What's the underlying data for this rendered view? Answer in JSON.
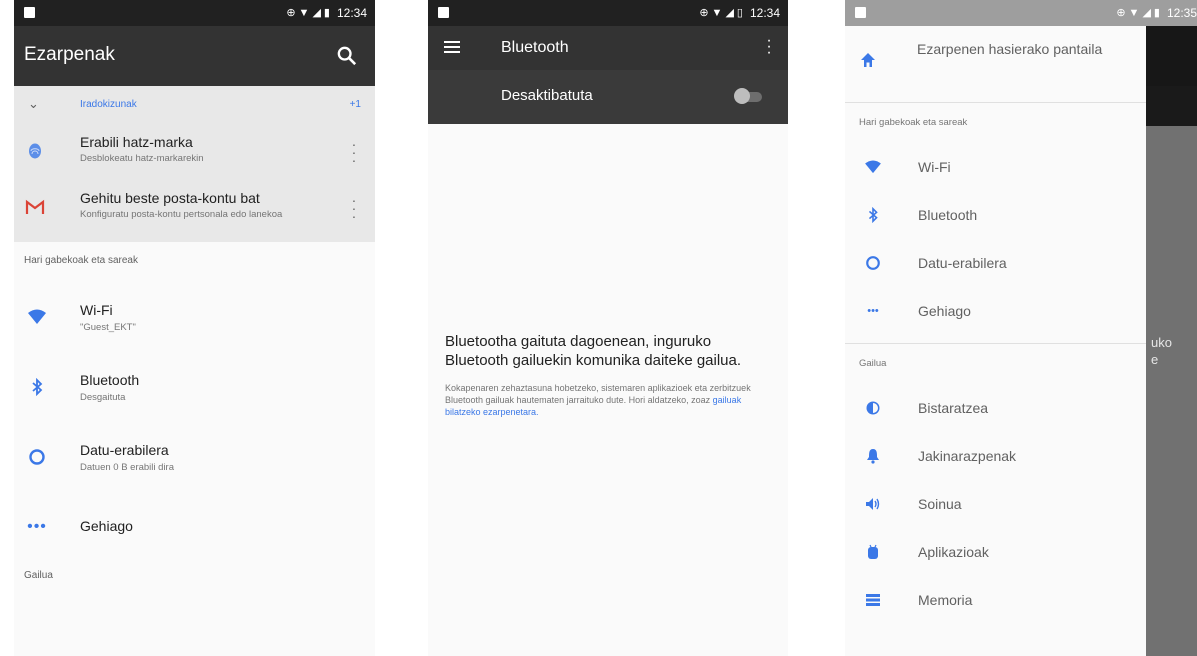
{
  "colors": {
    "accent": "#3b78e7",
    "gmail_red": "#db4437",
    "toolbar": "#333333"
  },
  "screen1": {
    "status": {
      "time": "12:34"
    },
    "toolbar": {
      "title": "Ezarpenak"
    },
    "suggestions": {
      "header": "Iradokizunak",
      "count": "+1",
      "items": [
        {
          "title": "Erabili hatz-marka",
          "subtitle": "Desblokeatu hatz-markarekin",
          "icon": "fingerprint-icon"
        },
        {
          "title": "Gehitu beste posta-kontu bat",
          "subtitle": "Konfiguratu posta-kontu pertsonala edo lanekoa",
          "icon": "gmail-icon"
        }
      ]
    },
    "section_wireless": "Hari gabekoak eta sareak",
    "rows": [
      {
        "title": "Wi-Fi",
        "subtitle": "\"Guest_EKT\"",
        "icon": "wifi-icon"
      },
      {
        "title": "Bluetooth",
        "subtitle": "Desgaituta",
        "icon": "bluetooth-icon"
      },
      {
        "title": "Datu-erabilera",
        "subtitle": "Datuen 0 B erabili dira",
        "icon": "data-usage-icon"
      },
      {
        "title": "Gehiago",
        "icon": "more-horiz-icon"
      }
    ],
    "section_device": "Gailua"
  },
  "screen2": {
    "status": {
      "time": "12:34"
    },
    "toolbar": {
      "title": "Bluetooth"
    },
    "toggle": {
      "label": "Desaktibatuta",
      "state": "off"
    },
    "message": "Bluetootha gaituta dagoenean, inguruko Bluetooth gailuekin komunika daiteke gailua.",
    "note": "Kokapenaren zehaztasuna hobetzeko, sistemaren aplikazioek eta zerbitzuek Bluetooth gailuak hautematen jarraituko dute. Hori aldatzeko, zoaz ",
    "note_link": "gailuak bilatzeko ezarpenetara."
  },
  "screen3": {
    "status": {
      "time": "12:35"
    },
    "drawer": {
      "home": "Ezarpenen hasierako pantaila",
      "section_wireless": "Hari gabekoak eta sareak",
      "wireless_items": [
        {
          "label": "Wi-Fi",
          "icon": "wifi-icon"
        },
        {
          "label": "Bluetooth",
          "icon": "bluetooth-icon"
        },
        {
          "label": "Datu-erabilera",
          "icon": "data-usage-icon"
        },
        {
          "label": "Gehiago",
          "icon": "more-horiz-icon"
        }
      ],
      "section_device": "Gailua",
      "device_items": [
        {
          "label": "Bistaratzea",
          "icon": "display-icon"
        },
        {
          "label": "Jakinarazpenak",
          "icon": "notifications-icon"
        },
        {
          "label": "Soinua",
          "icon": "sound-icon"
        },
        {
          "label": "Aplikazioak",
          "icon": "apps-icon"
        },
        {
          "label": "Memoria",
          "icon": "storage-icon"
        }
      ]
    },
    "background_text": [
      "uko",
      "e"
    ]
  }
}
